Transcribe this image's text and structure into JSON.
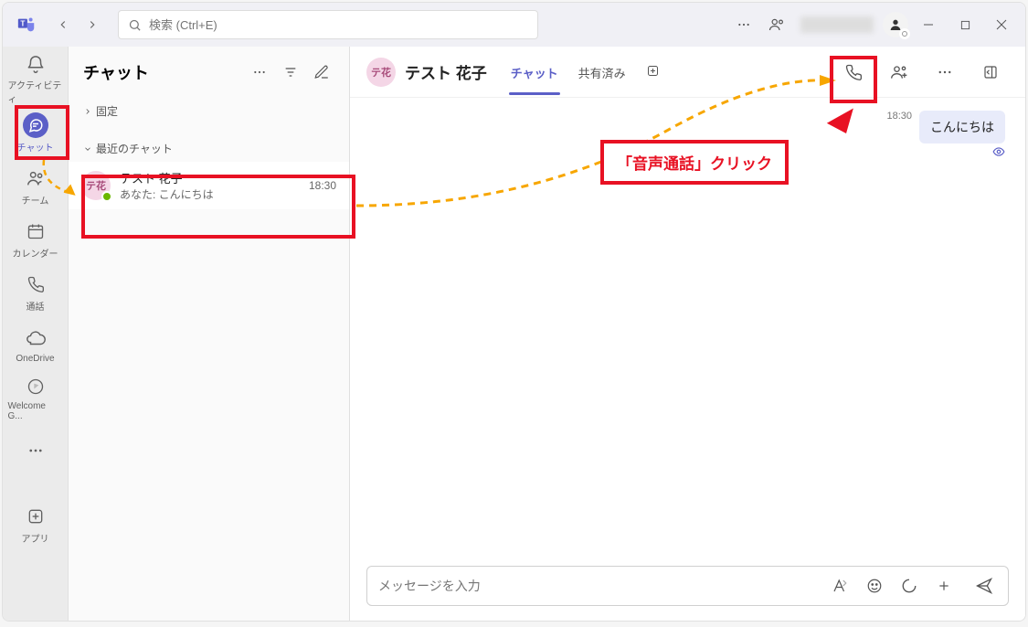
{
  "search": {
    "placeholder": "検索 (Ctrl+E)"
  },
  "rail": {
    "activity": "アクティビティ",
    "chat": "チャット",
    "teams": "チーム",
    "calendar": "カレンダー",
    "calls": "通話",
    "onedrive": "OneDrive",
    "welcome": "Welcome G...",
    "apps": "アプリ"
  },
  "list": {
    "title": "チャット",
    "section_pinned": "固定",
    "section_recent": "最近のチャット",
    "items": [
      {
        "initials": "テ花",
        "name": "テスト 花子",
        "preview": "あなた: こんにちは",
        "time": "18:30"
      }
    ]
  },
  "conv": {
    "initials": "テ花",
    "name": "テスト 花子",
    "tabs": {
      "chat": "チャット",
      "shared": "共有済み"
    },
    "message": {
      "time": "18:30",
      "text": "こんにちは"
    },
    "composer_placeholder": "メッセージを入力"
  },
  "annotation": {
    "callout": "「音声通話」クリック"
  }
}
